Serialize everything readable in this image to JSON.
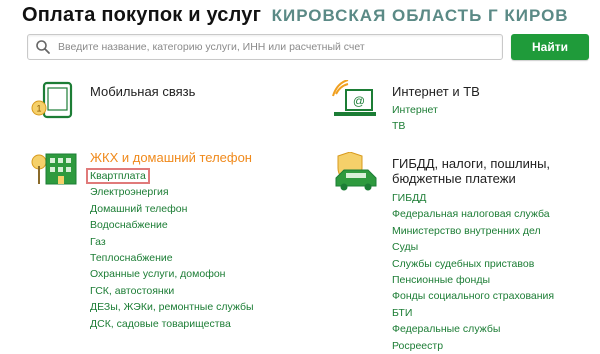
{
  "header": {
    "title": "Оплата покупок и услуг",
    "region": "КИРОВСКАЯ ОБЛАСТЬ Г КИРОВ"
  },
  "search": {
    "placeholder": "Введите название, категорию услуги, ИНН или расчетный счет",
    "value": "",
    "button_label": "Найти"
  },
  "categories": {
    "mobile": {
      "title": "Мобильная связь",
      "icon": "mobile-phone-icon",
      "items": []
    },
    "internet": {
      "title": "Интернет и ТВ",
      "icon": "computer-icon",
      "items": [
        "Интернет",
        "ТВ"
      ]
    },
    "zhkh": {
      "title": "ЖКХ и домашний телефон",
      "icon": "house-icon",
      "items": [
        "Квартплата",
        "Электроэнергия",
        "Домашний телефон",
        "Водоснабжение",
        "Газ",
        "Теплоснабжение",
        "Охранные услуги, домофон",
        "ГСК, автостоянки",
        "ДЕЗы, ЖЭКи, ремонтные службы",
        "ДСК, садовые товарищества"
      ],
      "selected": "Квартплата"
    },
    "gibdd": {
      "title_line1": "ГИБДД, налоги, пошлины,",
      "title_line2": "бюджетные платежи",
      "icon": "car-shield-icon",
      "items": [
        "ГИБДД",
        "Федеральная налоговая служба",
        "Министерство внутренних дел",
        "Суды",
        "Службы судебных приставов",
        "Пенсионные фонды",
        "Фонды социального страхования",
        "БТИ",
        "Федеральные службы",
        "Росреестр"
      ]
    }
  },
  "colors": {
    "accent_green": "#1f9b3a",
    "link_green": "#1c7d35",
    "region_teal": "#5b8a86",
    "highlight_orange": "#f08a1c",
    "selection_outline": "#e07a7a"
  }
}
